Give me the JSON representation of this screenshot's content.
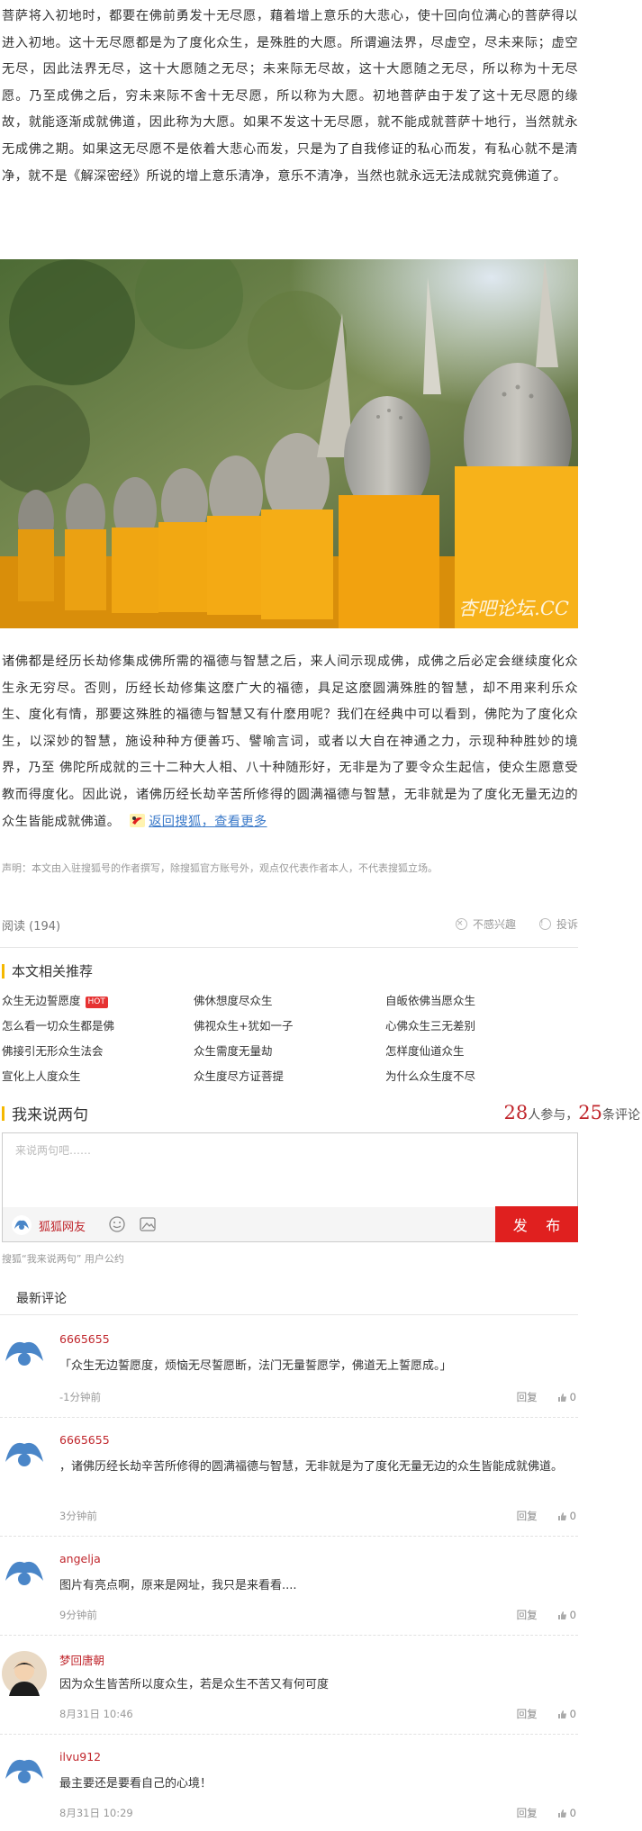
{
  "article": {
    "para1": "菩萨将入初地时，都要在佛前勇发十无尽愿，藉着增上意乐的大悲心，使十回向位满心的菩萨得以进入初地。这十无尽愿都是为了度化众生，是殊胜的大愿。所谓遍法界，尽虚空，尽未来际；虚空无尽，因此法界无尽，这十大愿随之无尽；未来际无尽故，这十大愿随之无尽，所以称为十无尽愿。乃至成佛之后，穷未来际不舍十无尽愿，所以称为大愿。初地菩萨由于发了这十无尽愿的缘故，就能逐渐成就佛道，因此称为大愿。如果不发这十无尽愿，就不能成就菩萨十地行，当然就永无成佛之期。如果这无尽愿不是依着大悲心而发，只是为了自我修证的私心而发，有私心就不是清净，就不是《解深密经》所说的增上意乐清净，意乐不清净，当然也就永远无法成就究竟佛道了。",
    "para2": "诸佛都是经历长劫修集成佛所需的福德与智慧之后，来人间示现成佛，成佛之后必定会继续度化众生永无穷尽。否则，历经长劫修集这麽广大的福德，具足这麽圆满殊胜的智慧，却不用来利乐众生、度化有情，那要这殊胜的福德与智慧又有什麽用呢？我们在经典中可以看到，佛陀为了度化众生，以深妙的智慧，施设种种方便善巧、譬喻言词，或者以大自在神通之力，示现种种胜妙的境界，乃至 佛陀所成就的三十二种大人相、八十种随形好，无非是为了要令众生起信，使众生愿意受教而得度化。因此说，诸佛历经长劫辛苦所修得的圆满福德与智慧，无非就是为了度化无量无边的众生皆能成就佛道。",
    "back_link": "返回搜狐，查看更多",
    "watermark": "杏吧论坛.CC",
    "statement": "声明：本文由入驻搜狐号的作者撰写，除搜狐官方账号外，观点仅代表作者本人，不代表搜狐立场。",
    "reads": "阅读 (194)",
    "not_interested": "不感兴趣",
    "report": "投诉"
  },
  "related": {
    "title": "本文相关推荐",
    "hot_badge": "HOT",
    "items": [
      "众生无边誓愿度",
      "佛休想度尽众生",
      "自皈依佛当愿众生",
      "怎么看一切众生都是佛",
      "佛视众生+犹如一子",
      "心佛众生三无差别",
      "佛接引无形众生法会",
      "众生需度无量劫",
      "怎样度仙道众生",
      "宣化上人度众生",
      "众生度尽方证菩提",
      "为什么众生度不尽"
    ]
  },
  "comment_section": {
    "title": "我来说两句",
    "participants": "28",
    "participants_label": "人参与，",
    "comments": "25",
    "comments_label": "条评论",
    "placeholder": "来说两句吧……",
    "user": "狐狐网友",
    "submit": "发 布",
    "pact": "搜狐“我来说两句” 用户公约",
    "latest_title": "最新评论"
  },
  "comments": [
    {
      "user": "6665655",
      "text": "「众生无边誓愿度，烦恼无尽誓愿断，法门无量誓愿学，佛道无上誓愿成。」",
      "time": "-1分钟前",
      "reply": "回复",
      "likes": "0"
    },
    {
      "user": "6665655",
      "text": "，诸佛历经长劫辛苦所修得的圆满福德与智慧，无非就是为了度化无量无边的众生皆能成就佛道。",
      "time": "3分钟前",
      "reply": "回复",
      "likes": "0"
    },
    {
      "user": "angelja",
      "text": "图片有亮点啊，原来是网址，我只是来看看....",
      "time": "9分钟前",
      "reply": "回复",
      "likes": "0"
    },
    {
      "user": "梦回唐朝",
      "text": "因为众生皆苦所以度众生，若是众生不苦又有何可度",
      "time": "8月31日 10:46",
      "reply": "回复",
      "likes": "0"
    },
    {
      "user": "ilvu912",
      "text": "最主要还是要看自己的心境！",
      "time": "8月31日 10:29",
      "reply": "回复",
      "likes": "0"
    }
  ],
  "colors": {
    "accent_red": "#c0262c",
    "submit_red": "#e0201f",
    "link_blue": "#3b7ac9",
    "section_bar": "#f5b800",
    "robe_orange": "#f2a20f"
  },
  "icons": [
    "sohu-logo-icon",
    "not-interested-icon",
    "report-icon",
    "avatar-icon",
    "emoji-icon",
    "image-icon",
    "thumb-up-icon"
  ]
}
